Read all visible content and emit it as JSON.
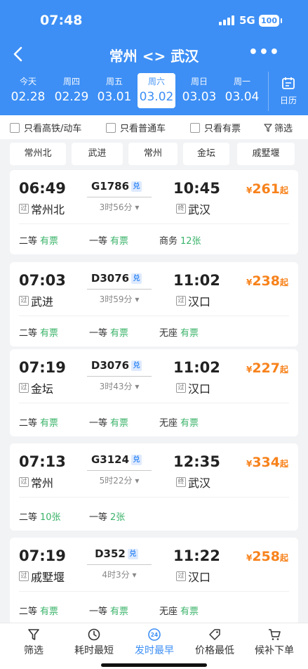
{
  "status_bar": {
    "time": "07:48",
    "network": "5G",
    "battery": "100"
  },
  "nav": {
    "title": "常州 <> 武汉"
  },
  "dates": [
    {
      "weekday": "今天",
      "date": "02.28",
      "active": false
    },
    {
      "weekday": "周四",
      "date": "02.29",
      "active": false
    },
    {
      "weekday": "周五",
      "date": "03.01",
      "active": false
    },
    {
      "weekday": "周六",
      "date": "03.02",
      "active": true
    },
    {
      "weekday": "周日",
      "date": "03.03",
      "active": false
    },
    {
      "weekday": "周一",
      "date": "03.04",
      "active": false
    }
  ],
  "calendar_label": "日历",
  "filters": {
    "high_speed": "只看高铁/动车",
    "normal": "只看普通车",
    "available": "只看有票",
    "filter": "筛选"
  },
  "stations": [
    "常州北",
    "武进",
    "常州",
    "金坛",
    "戚墅堰"
  ],
  "trains": [
    {
      "dep_time": "06:49",
      "arr_time": "10:45",
      "code": "G1786",
      "dui": "兑",
      "duration": "3时56分",
      "from_tag": "过",
      "from": "常州北",
      "to_tag": "终",
      "to": "武汉",
      "price": "261",
      "price_suffix": "起",
      "seats": [
        {
          "class": "二等",
          "status": "有票"
        },
        {
          "class": "一等",
          "status": "有票"
        },
        {
          "class": "商务",
          "status": "12张"
        }
      ]
    },
    {
      "dep_time": "07:03",
      "arr_time": "11:02",
      "code": "D3076",
      "dui": "兑",
      "duration": "3时59分",
      "from_tag": "过",
      "from": "武进",
      "to_tag": "过",
      "to": "汉口",
      "price": "238",
      "price_suffix": "起",
      "seats": [
        {
          "class": "二等",
          "status": "有票"
        },
        {
          "class": "一等",
          "status": "有票"
        },
        {
          "class": "无座",
          "status": "有票"
        }
      ]
    },
    {
      "dep_time": "07:19",
      "arr_time": "11:02",
      "code": "D3076",
      "dui": "兑",
      "duration": "3时43分",
      "from_tag": "过",
      "from": "金坛",
      "to_tag": "过",
      "to": "汉口",
      "price": "227",
      "price_suffix": "起",
      "seats": [
        {
          "class": "二等",
          "status": "有票"
        },
        {
          "class": "一等",
          "status": "有票"
        },
        {
          "class": "无座",
          "status": "有票"
        }
      ]
    },
    {
      "dep_time": "07:13",
      "arr_time": "12:35",
      "code": "G3124",
      "dui": "兑",
      "duration": "5时22分",
      "from_tag": "过",
      "from": "常州",
      "to_tag": "终",
      "to": "武汉",
      "price": "334",
      "price_suffix": "起",
      "seats": [
        {
          "class": "二等",
          "status": "10张"
        },
        {
          "class": "一等",
          "status": "2张"
        }
      ]
    },
    {
      "dep_time": "07:19",
      "arr_time": "11:22",
      "code": "D352",
      "dui": "兑",
      "duration": "4时3分",
      "from_tag": "过",
      "from": "戚墅堰",
      "to_tag": "过",
      "to": "汉口",
      "price": "258",
      "price_suffix": "起",
      "seats": [
        {
          "class": "二等",
          "status": "有票"
        },
        {
          "class": "一等",
          "status": "有票"
        },
        {
          "class": "无座",
          "status": "有票"
        }
      ]
    }
  ],
  "currency": "¥",
  "bottom_bar": [
    {
      "label": "筛选",
      "icon": "filter-icon",
      "active": false
    },
    {
      "label": "耗时最短",
      "icon": "clock-icon",
      "active": false
    },
    {
      "label": "发时最早",
      "icon": "24h-icon",
      "badge": "24",
      "active": true
    },
    {
      "label": "价格最低",
      "icon": "price-tag-icon",
      "active": false
    },
    {
      "label": "候补下单",
      "icon": "cart-icon",
      "active": false
    }
  ],
  "colors": {
    "primary": "#3d8ff5",
    "price": "#f7821b",
    "available": "#3bb36a"
  }
}
